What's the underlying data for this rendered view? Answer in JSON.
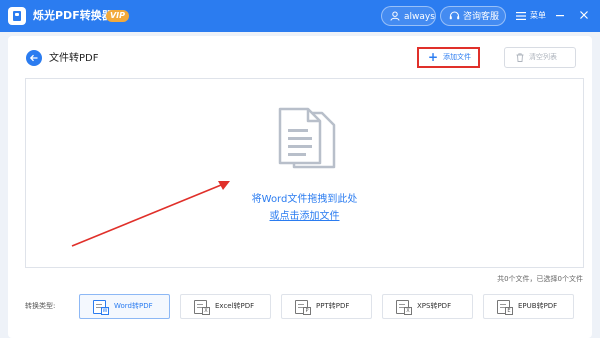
{
  "titlebar": {
    "app_name": "烁光PDF转换器",
    "vip_label": "VIP",
    "user_label": "always",
    "service_label": "咨询客服",
    "menu_label": "菜单"
  },
  "header": {
    "title": "文件转PDF",
    "add_file_label": "添加文件",
    "clear_list_label": "清空列表"
  },
  "drop_zone": {
    "hint_line": "将Word文件拖拽到此处",
    "click_line": "或点击添加文件"
  },
  "file_count": "共0个文件，已选择0个文件",
  "convert_type": {
    "label": "转换类型:",
    "options": [
      {
        "label": "Word转PDF",
        "glyph": "W",
        "active": true
      },
      {
        "label": "Excel转PDF",
        "glyph": "X",
        "active": false
      },
      {
        "label": "PPT转PDF",
        "glyph": "P",
        "active": false
      },
      {
        "label": "XPS转PDF",
        "glyph": "X",
        "active": false
      },
      {
        "label": "EPUB转PDF",
        "glyph": "E",
        "active": false
      }
    ]
  },
  "colors": {
    "accent": "#2b7cf0",
    "vip_badge": "#f2a93b",
    "highlight_border": "#e0302a",
    "annotation_arrow": "#e0302a"
  },
  "icons": [
    "app-logo-icon",
    "user-icon",
    "headset-icon",
    "menu-icon",
    "minimize-icon",
    "close-icon",
    "back-arrow-icon",
    "plus-icon",
    "trash-icon",
    "document-icon",
    "annotation-arrow"
  ]
}
